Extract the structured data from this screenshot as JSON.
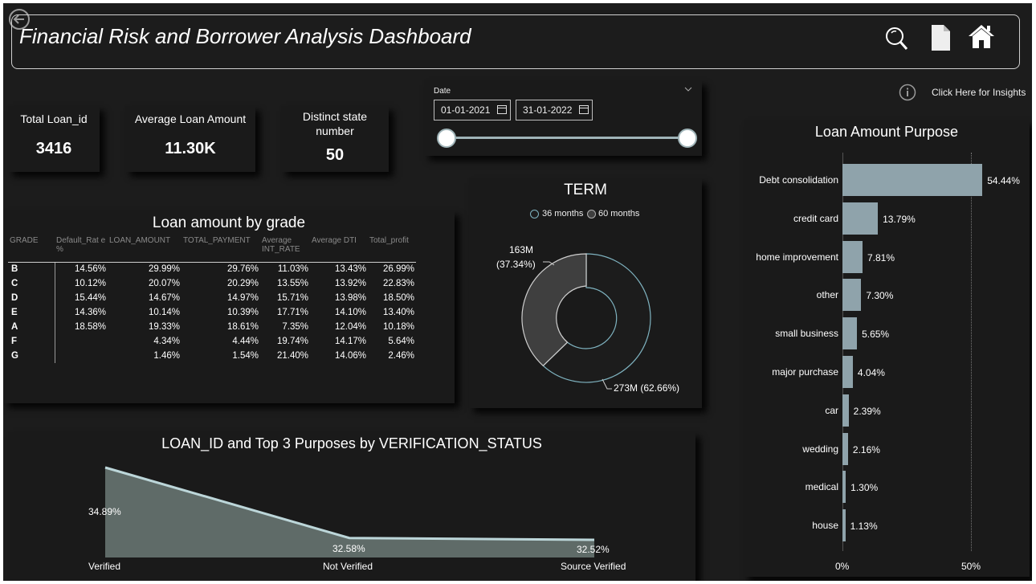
{
  "header": {
    "title": "Financial Risk and Borrower Analysis Dashboard"
  },
  "kpis": {
    "total_loan_label": "Total Loan_id",
    "total_loan_value": "3416",
    "avg_loan_label": "Average Loan Amount",
    "avg_loan_value": "11.30K",
    "state_label": "Distinct state number",
    "state_value": "50"
  },
  "date_filter": {
    "label": "Date",
    "start": "01-01-2021",
    "end": "31-01-2022"
  },
  "insights": {
    "label": "Click Here for Insights"
  },
  "grade_table": {
    "title": "Loan amount by grade",
    "columns": [
      "GRADE",
      "Default_Rat e %",
      "LOAN_AMOUNT",
      "TOTAL_PAYMENT",
      "Average INT_RATE",
      "Average DTI",
      "Total_profit"
    ],
    "rows": [
      [
        "B",
        "14.56%",
        "29.99%",
        "29.76%",
        "11.03%",
        "13.43%",
        "26.99%"
      ],
      [
        "C",
        "10.12%",
        "20.07%",
        "20.29%",
        "13.55%",
        "13.92%",
        "22.83%"
      ],
      [
        "D",
        "15.44%",
        "14.67%",
        "14.97%",
        "15.71%",
        "13.98%",
        "18.50%"
      ],
      [
        "E",
        "14.36%",
        "10.14%",
        "10.39%",
        "17.71%",
        "14.10%",
        "13.40%"
      ],
      [
        "A",
        "18.58%",
        "19.33%",
        "18.61%",
        "7.35%",
        "12.04%",
        "10.18%"
      ],
      [
        "F",
        "",
        "4.34%",
        "4.44%",
        "19.74%",
        "14.17%",
        "5.64%"
      ],
      [
        "G",
        "",
        "1.46%",
        "1.54%",
        "21.40%",
        "14.06%",
        "2.46%"
      ]
    ]
  },
  "term_chart": {
    "title": "TERM",
    "legend": [
      "36 months",
      "60 months"
    ],
    "label_60": "163M",
    "label_60_pct": "(37.34%)",
    "label_36": "273M (62.66%)",
    "colors": {
      "36 months": "#1c1c1c",
      "60 months": "#3f3f3f",
      "ring": "#7fb3c0"
    }
  },
  "chart_data": [
    {
      "type": "bar",
      "title": "Loan Amount Purpose",
      "categories": [
        "Debt consolidation",
        "credit card",
        "home improvement",
        "other",
        "small business",
        "major purchase",
        "car",
        "wedding",
        "medical",
        "house"
      ],
      "values": [
        54.44,
        13.79,
        7.81,
        7.3,
        5.65,
        4.04,
        2.39,
        2.16,
        1.3,
        1.13
      ],
      "value_labels": [
        "54.44%",
        "13.79%",
        "7.81%",
        "7.30%",
        "5.65%",
        "4.04%",
        "2.39%",
        "2.16%",
        "1.30%",
        "1.13%"
      ],
      "xticks": [
        "0%",
        "50%"
      ],
      "xlim": [
        0,
        55
      ],
      "bar_color": "#8fa3ab"
    },
    {
      "type": "area",
      "title": "LOAN_ID and Top 3 Purposes by VERIFICATION_STATUS",
      "categories": [
        "Verified",
        "Not Verified",
        "Source Verified"
      ],
      "values": [
        34.89,
        32.58,
        32.52
      ],
      "value_labels": [
        "34.89%",
        "32.58%",
        "32.52%"
      ],
      "fill_color": "#5f6b68",
      "line_color": "#bcd6d9"
    },
    {
      "type": "pie",
      "title": "TERM",
      "categories": [
        "36 months",
        "60 months"
      ],
      "values": [
        62.66,
        37.34
      ]
    }
  ]
}
